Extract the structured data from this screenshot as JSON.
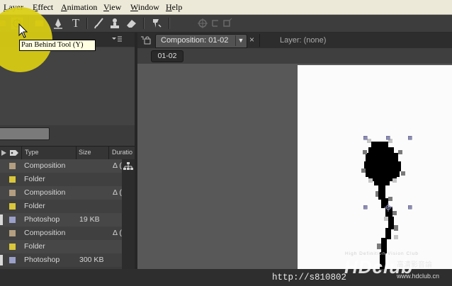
{
  "menu": {
    "items": [
      "Layer",
      "Effect",
      "Animation",
      "View",
      "Window",
      "Help"
    ]
  },
  "tooltip": {
    "text": "Pan Behind Tool (Y)"
  },
  "project": {
    "columns": {
      "type": "Type",
      "size": "Size",
      "duration": "Duratio"
    },
    "rows": [
      {
        "type": "Composition",
        "size": "",
        "dur": "Δ (",
        "color": "#b39e80"
      },
      {
        "type": "Folder",
        "size": "",
        "dur": "",
        "color": "#d9c63a"
      },
      {
        "type": "Composition",
        "size": "",
        "dur": "Δ (",
        "color": "#b39e80"
      },
      {
        "type": "Folder",
        "size": "",
        "dur": "",
        "color": "#d9c63a"
      },
      {
        "type": "Photoshop",
        "size": "19 KB",
        "dur": "",
        "color": "#9aa0c8"
      },
      {
        "type": "Composition",
        "size": "",
        "dur": "Δ (",
        "color": "#b39e80"
      },
      {
        "type": "Folder",
        "size": "",
        "dur": "",
        "color": "#d9c63a"
      },
      {
        "type": "Photoshop",
        "size": "300 KB",
        "dur": "",
        "color": "#9aa0c8"
      }
    ]
  },
  "viewer": {
    "comp_tab": "Composition: 01-02",
    "layer_tab": "Layer: (none)",
    "breadcrumb": "01-02"
  },
  "watermark": {
    "url": "http://s810802",
    "logo_sub": "High Definition Vision Club",
    "logo_main": "HDclub",
    "logo_cjk": "高清影音論",
    "logo_web": "www.hdclub.cn"
  },
  "colors": {
    "halo": "#dace12",
    "tooltip_bg": "#ffffe1",
    "panel_bg": "#3b3b3b"
  }
}
